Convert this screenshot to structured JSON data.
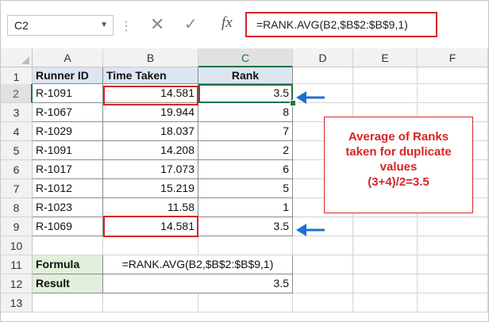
{
  "formula_bar": {
    "name_box": "C2",
    "formula": "=RANK.AVG(B2,$B$2:$B$9,1)",
    "fx_label": "fx"
  },
  "columns": [
    "A",
    "B",
    "C",
    "D",
    "E",
    "F"
  ],
  "rows": [
    "1",
    "2",
    "3",
    "4",
    "5",
    "6",
    "7",
    "8",
    "9",
    "10",
    "11",
    "12",
    "13"
  ],
  "table": {
    "headers": [
      "Runner ID",
      "Time Taken",
      "Rank"
    ],
    "data": [
      [
        "R-1091",
        "14.581",
        "3.5"
      ],
      [
        "R-1067",
        "19.944",
        "8"
      ],
      [
        "R-1029",
        "18.037",
        "7"
      ],
      [
        "R-1091",
        "14.208",
        "2"
      ],
      [
        "R-1017",
        "17.073",
        "6"
      ],
      [
        "R-1012",
        "15.219",
        "5"
      ],
      [
        "R-1023",
        "11.58",
        "1"
      ],
      [
        "R-1069",
        "14.581",
        "3.5"
      ]
    ]
  },
  "summary": {
    "formula_label": "Formula",
    "formula_text": "=RANK.AVG(B2,$B$2:$B$9,1)",
    "result_label": "Result",
    "result_value": "3.5"
  },
  "annotation": {
    "lines": [
      "Average of Ranks",
      "taken for duplicate",
      "values",
      "(3+4)/2=3.5"
    ]
  },
  "colors": {
    "highlight_red": "#d52525",
    "arrow_blue": "#1f6fd1",
    "excel_green": "#217346",
    "header_fill": "#dce6f1",
    "label_fill": "#e2efda"
  }
}
